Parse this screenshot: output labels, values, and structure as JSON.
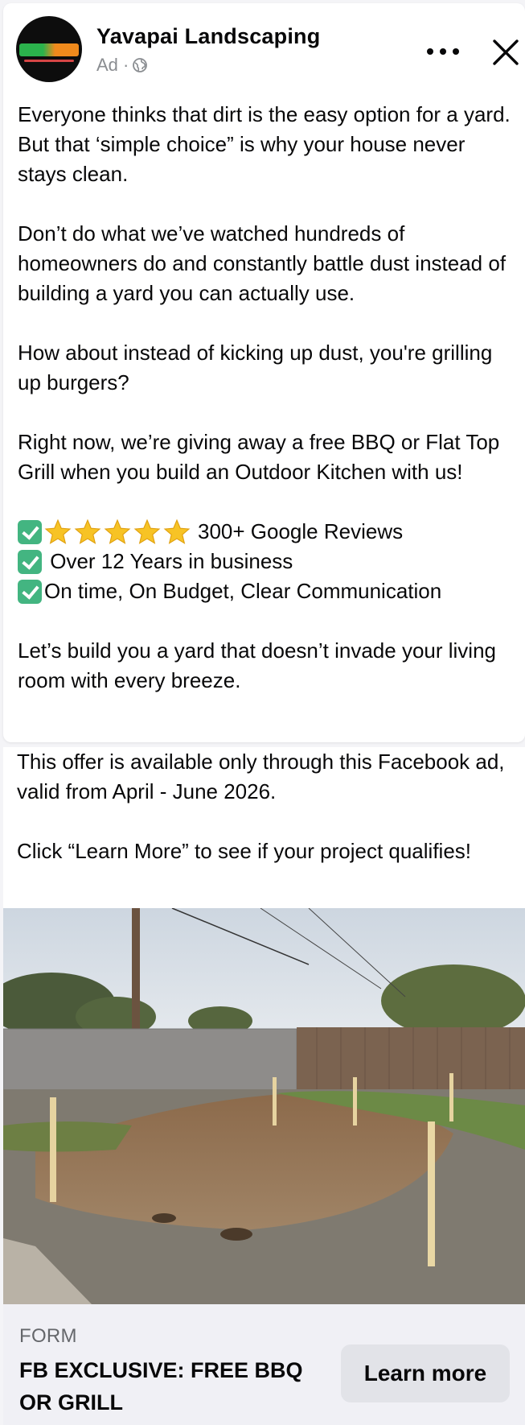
{
  "header": {
    "page_name": "Yavapai Landscaping",
    "sponsored_label": "Ad ·",
    "avatar_icon": "company-logo-icon",
    "audience_icon": "globe-icon",
    "more_icon": "more-dots-icon",
    "close_icon": "close-icon"
  },
  "post": {
    "paragraph_1": "Everyone thinks that dirt is the easy option for a yard. But that ‘simple choice” is why your house never stays clean.",
    "paragraph_2": "Don’t do what we’ve watched hundreds of homeowners do and constantly battle dust instead of building a yard you can actually use.",
    "paragraph_3": "How about instead of kicking up dust, you're grilling up burgers?",
    "paragraph_4": "Right now, we’re giving away a free BBQ or Flat Top Grill when you build an Outdoor Kitchen with us!",
    "checklist": [
      {
        "text": "300+ Google Reviews",
        "stars": 5
      },
      {
        "text": " Over 12 Years in business",
        "stars": 0
      },
      {
        "text": "On time, On Budget, Clear Communication",
        "stars": 0
      }
    ],
    "paragraph_5": "Let’s build you a yard that doesn’t invade your living room with every breeze.",
    "paragraph_6": "This offer is available only through this Facebook ad, valid from April - June 2026.",
    "paragraph_7": "Click “Learn More” to see if your project qualifies!"
  },
  "cta": {
    "caption": "FORM",
    "headline": "FB EXCLUSIVE: FREE BBQ OR GRILL",
    "button_label": "Learn more"
  },
  "colors": {
    "check_green": "#43b581",
    "star_gold": "#f7c325",
    "muted_text": "#65676b",
    "cta_background": "#f0f0f5",
    "button_background": "#e2e3e8"
  }
}
